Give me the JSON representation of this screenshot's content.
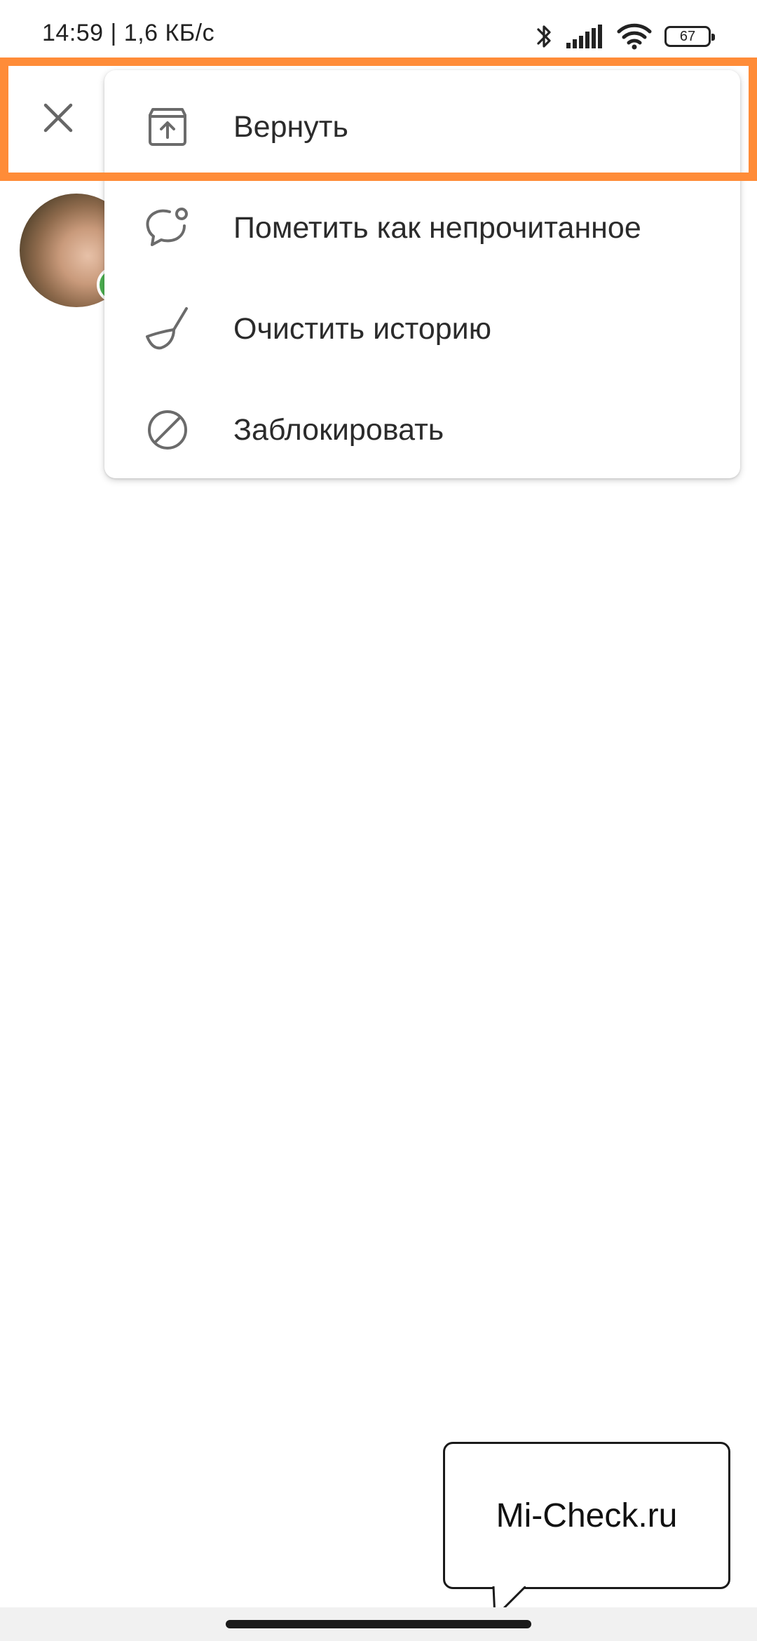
{
  "status_bar": {
    "time_and_speed": "14:59 | 1,6 КБ/с",
    "battery_level": "67",
    "icons": [
      "bluetooth-icon",
      "signal-icon",
      "wifi-icon",
      "battery-icon"
    ]
  },
  "header": {
    "close_icon": "close-icon"
  },
  "menu": {
    "items": [
      {
        "label": "Вернуть",
        "icon": "unarchive-icon"
      },
      {
        "label": "Пометить как непрочитанное",
        "icon": "mark-unread-icon"
      },
      {
        "label": "Очистить историю",
        "icon": "broom-icon"
      },
      {
        "label": "Заблокировать",
        "icon": "block-icon"
      }
    ]
  },
  "watermark": {
    "text": "Mi-Check.ru"
  },
  "colors": {
    "highlight": "#ff8c38",
    "icon": "#6b6b6b",
    "text": "#2b2b2b",
    "online": "#4caf50"
  }
}
